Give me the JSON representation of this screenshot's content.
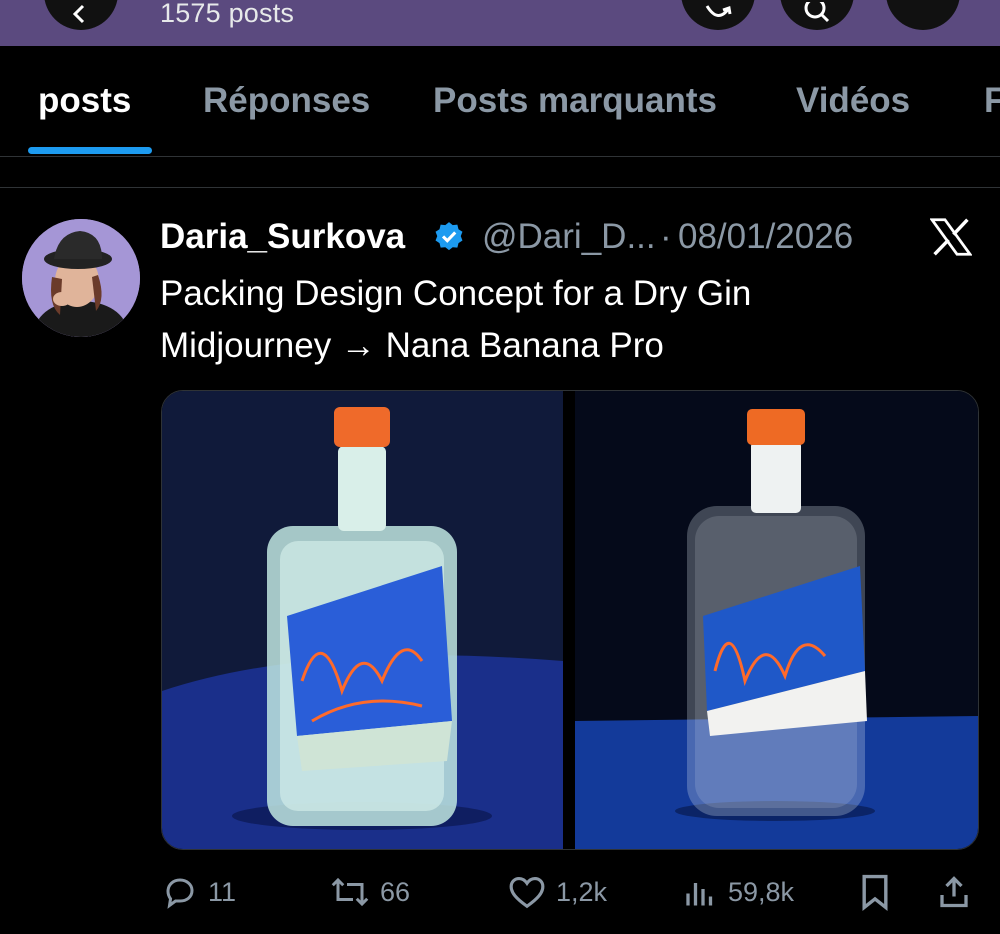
{
  "header": {
    "post_count": "1575 posts"
  },
  "tabs": [
    {
      "label": "posts",
      "active": true
    },
    {
      "label": "Réponses",
      "active": false
    },
    {
      "label": "Posts marquants",
      "active": false
    },
    {
      "label": "Vidéos",
      "active": false
    },
    {
      "label": "F",
      "active": false
    }
  ],
  "tweet": {
    "author": "Daria_Surkova",
    "handle": "@Dari_D...",
    "separator": "·",
    "date": "08/01/2026",
    "text_line1": "Packing Design Concept for a Dry Gin",
    "text_line2": "Midjourney → Nana Banana Pro",
    "stats": {
      "replies": "11",
      "reposts": "66",
      "likes": "1,2k",
      "views": "59,8k"
    }
  },
  "colors": {
    "header_bg": "#5b4a7f",
    "accent": "#1d9bf0",
    "muted_text": "#8b98a5",
    "background": "#000000"
  },
  "icons": [
    "back-icon",
    "refresh-icon",
    "search-icon",
    "more-icon",
    "verified-icon",
    "x-logo-icon",
    "reply-icon",
    "repost-icon",
    "like-icon",
    "views-icon",
    "bookmark-icon",
    "share-icon"
  ]
}
